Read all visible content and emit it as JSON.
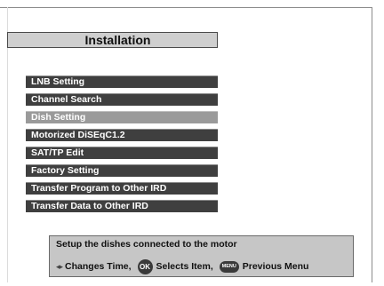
{
  "header": {
    "title": "Installation"
  },
  "menu": {
    "items": [
      {
        "label": "LNB Setting"
      },
      {
        "label": "Channel Search"
      },
      {
        "label": "Dish Setting"
      },
      {
        "label": "Motorized DiSEqC1.2"
      },
      {
        "label": "SAT/TP Edit"
      },
      {
        "label": "Factory Setting"
      },
      {
        "label": "Transfer Program to Other IRD"
      },
      {
        "label": "Transfer Data to Other IRD"
      }
    ],
    "selected_index": 2
  },
  "help": {
    "description": "Setup the dishes connected to the motor",
    "hints": {
      "arrows_icon": "left-right-arrows-icon",
      "arrows_glyph": "◂▸",
      "change_label": "Changes Time,",
      "ok_icon": "ok-button-icon",
      "ok_glyph": "OK",
      "select_label": "Selects Item,",
      "menu_icon": "menu-button-icon",
      "menu_glyph": "MENU",
      "previous_label": "Previous Menu"
    }
  },
  "colors": {
    "menu_item_bg": "#3f3f3f",
    "menu_item_selected_bg": "#9a9a9a",
    "title_bg": "#cfcfcf",
    "help_bg": "#c6c6c6"
  }
}
